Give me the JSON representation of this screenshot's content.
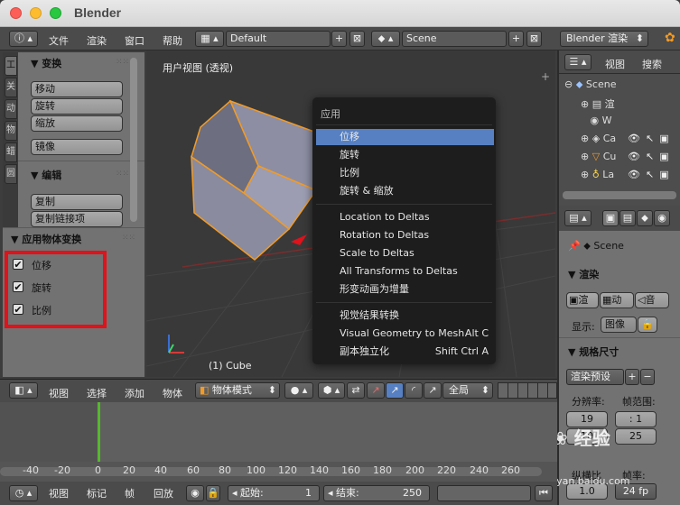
{
  "window": {
    "title": "Blender"
  },
  "infobar": {
    "menus": [
      "文件",
      "渲染",
      "窗口",
      "帮助"
    ],
    "screen_layout": "Default",
    "scene": "Scene",
    "render_engine": "Blender 渲染"
  },
  "toolshelf": {
    "tabs": [
      "工",
      "关",
      "动",
      "物",
      "蜡",
      "圆"
    ],
    "transform_header": "变换",
    "transform_buttons": [
      "移动",
      "旋转",
      "缩放"
    ],
    "mirror_button": "镜像",
    "edit_header": "编辑",
    "edit_buttons": [
      "复制",
      "复制链接项"
    ],
    "apply_header": "应用物体变换",
    "apply_options": [
      {
        "label": "位移",
        "checked": true
      },
      {
        "label": "旋转",
        "checked": true
      },
      {
        "label": "比例",
        "checked": true
      }
    ]
  },
  "viewport": {
    "view_label": "用户视图 (透视)",
    "object_label": "(1) Cube"
  },
  "apply_menu": {
    "title": "应用",
    "group1": [
      "位移",
      "旋转",
      "比例",
      "旋转 & 缩放"
    ],
    "group2": [
      "Location to Deltas",
      "Rotation to Deltas",
      "Scale to Deltas",
      "All Transforms to Deltas",
      "形变动画为增量"
    ],
    "group3": [
      {
        "label": "视觉结果转换",
        "shortcut": ""
      },
      {
        "label": "Visual Geometry to Mesh",
        "shortcut": "Alt C"
      },
      {
        "label": "副本独立化",
        "shortcut": "Shift Ctrl A"
      }
    ]
  },
  "outliner": {
    "view_menu": "视图",
    "search_menu": "搜索",
    "items": [
      "Scene",
      "渲",
      "W",
      "Ca",
      "Cu",
      "La"
    ]
  },
  "properties": {
    "scene_label": "Scene",
    "render_header": "渲染",
    "render_buttons": [
      "渲",
      "动",
      "音"
    ],
    "display_label": "显示:",
    "display_value": "图像",
    "dimensions_header": "规格尺寸",
    "preset_label": "渲染预设",
    "resolution_label": "分辨率:",
    "frame_range_label": "帧范围:",
    "res_x": "19",
    "res_y": "10",
    "frame_start": ": 1",
    "frame_end": "25",
    "aspect_label": "纵横比",
    "fps_label": "帧率:",
    "aspect_value": "1.0",
    "fps_value": "24 fp"
  },
  "view3d_header": {
    "menus": [
      "视图",
      "选择",
      "添加",
      "物体"
    ],
    "mode": "物体模式",
    "orientation": "全局"
  },
  "timeline": {
    "ticks": [
      "-40",
      "-20",
      "0",
      "20",
      "40",
      "60",
      "80",
      "100",
      "120",
      "140",
      "160",
      "180",
      "200",
      "220",
      "240",
      "260"
    ],
    "current_frame": 0
  },
  "bottombar": {
    "menus": [
      "视图",
      "标记",
      "帧",
      "回放"
    ],
    "start_label": "起始:",
    "start_value": "1",
    "end_label": "结束:",
    "end_value": "250"
  },
  "watermark": {
    "text": "经验",
    "url": "jingyan.baidu.com"
  },
  "colors": {
    "menu_highlight": "#5680c2",
    "red_box": "#e0121b",
    "selection_orange": "#f29b26",
    "frame_cursor": "#56b82e"
  }
}
